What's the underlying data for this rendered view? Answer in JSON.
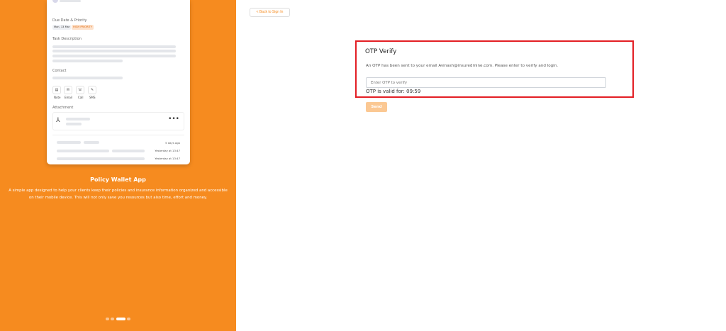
{
  "showcase": {
    "card": {
      "due_label": "Due Date & Priority",
      "due_date": "Mon, 13 Mar",
      "priority": "HIGH PRIORITY",
      "task_desc_label": "Task Description",
      "contact_label": "Contact",
      "actions": [
        {
          "label": "Note",
          "icon": "note-icon"
        },
        {
          "label": "Email",
          "icon": "mail-icon"
        },
        {
          "label": "Call",
          "icon": "phone-icon"
        },
        {
          "label": "SMS",
          "icon": "sms-icon"
        }
      ],
      "attachment_label": "Attachment",
      "activity_times": [
        "5 days ago",
        "Yesterday at 13:47",
        "Yesterday at 13:47"
      ]
    },
    "title": "Policy Wallet App",
    "description": "A simple app designed to help your clients keep their policies and insurance information organized and accessible on their mobile device. This will not only save you resources but also time, effort and money.",
    "carousel": {
      "total": 4,
      "active_index": 2
    }
  },
  "back_button": "< Back to Sign In",
  "otp": {
    "title": "OTP Verify",
    "message": "An OTP has been sent to your email Avinash@insuredmine.com. Please enter to verify and login.",
    "input_placeholder": "Enter OTP to verify",
    "validity": "OTP is valid for: 09:59",
    "send_label": "Send"
  },
  "colors": {
    "brand": "#f68b1f",
    "highlight_border": "#e31e24",
    "send_disabled": "#fbc893"
  }
}
